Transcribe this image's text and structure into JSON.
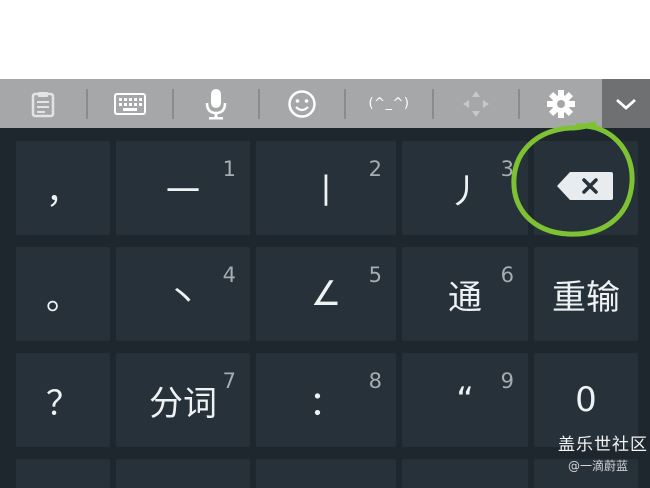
{
  "toolbar": {
    "items": [
      {
        "icon": "clipboard-icon"
      },
      {
        "icon": "keyboard-icon"
      },
      {
        "icon": "microphone-icon"
      },
      {
        "icon": "emoji-icon"
      },
      {
        "icon": "kaomoji-icon",
        "label": "(^_^)"
      },
      {
        "icon": "cursor-move-icon"
      },
      {
        "icon": "gear-icon"
      },
      {
        "icon": "chevron-down-icon"
      }
    ]
  },
  "keys": [
    {
      "label": "，",
      "num": ""
    },
    {
      "label": "一",
      "num": "1"
    },
    {
      "label": "丨",
      "num": "2"
    },
    {
      "label": "丿",
      "num": "3"
    },
    {
      "label": "",
      "num": "",
      "icon": "backspace-icon"
    },
    {
      "label": "。",
      "num": ""
    },
    {
      "label": "丶",
      "num": "4"
    },
    {
      "label": "∠",
      "num": "5"
    },
    {
      "label": "通",
      "num": "6"
    },
    {
      "label": "重输",
      "num": ""
    },
    {
      "label": "？",
      "num": ""
    },
    {
      "label": "分词",
      "num": "7"
    },
    {
      "label": "：",
      "num": "8"
    },
    {
      "label": "“",
      "num": "9"
    },
    {
      "label": "0",
      "num": ""
    }
  ],
  "watermark": {
    "title": "盖乐世社区",
    "subtitle": "@一滴蔚蓝"
  },
  "colors": {
    "toolbar": "#a6a7a8",
    "keyboard": "#1e272d",
    "key": "#26313a",
    "annotation": "#7ec234"
  }
}
